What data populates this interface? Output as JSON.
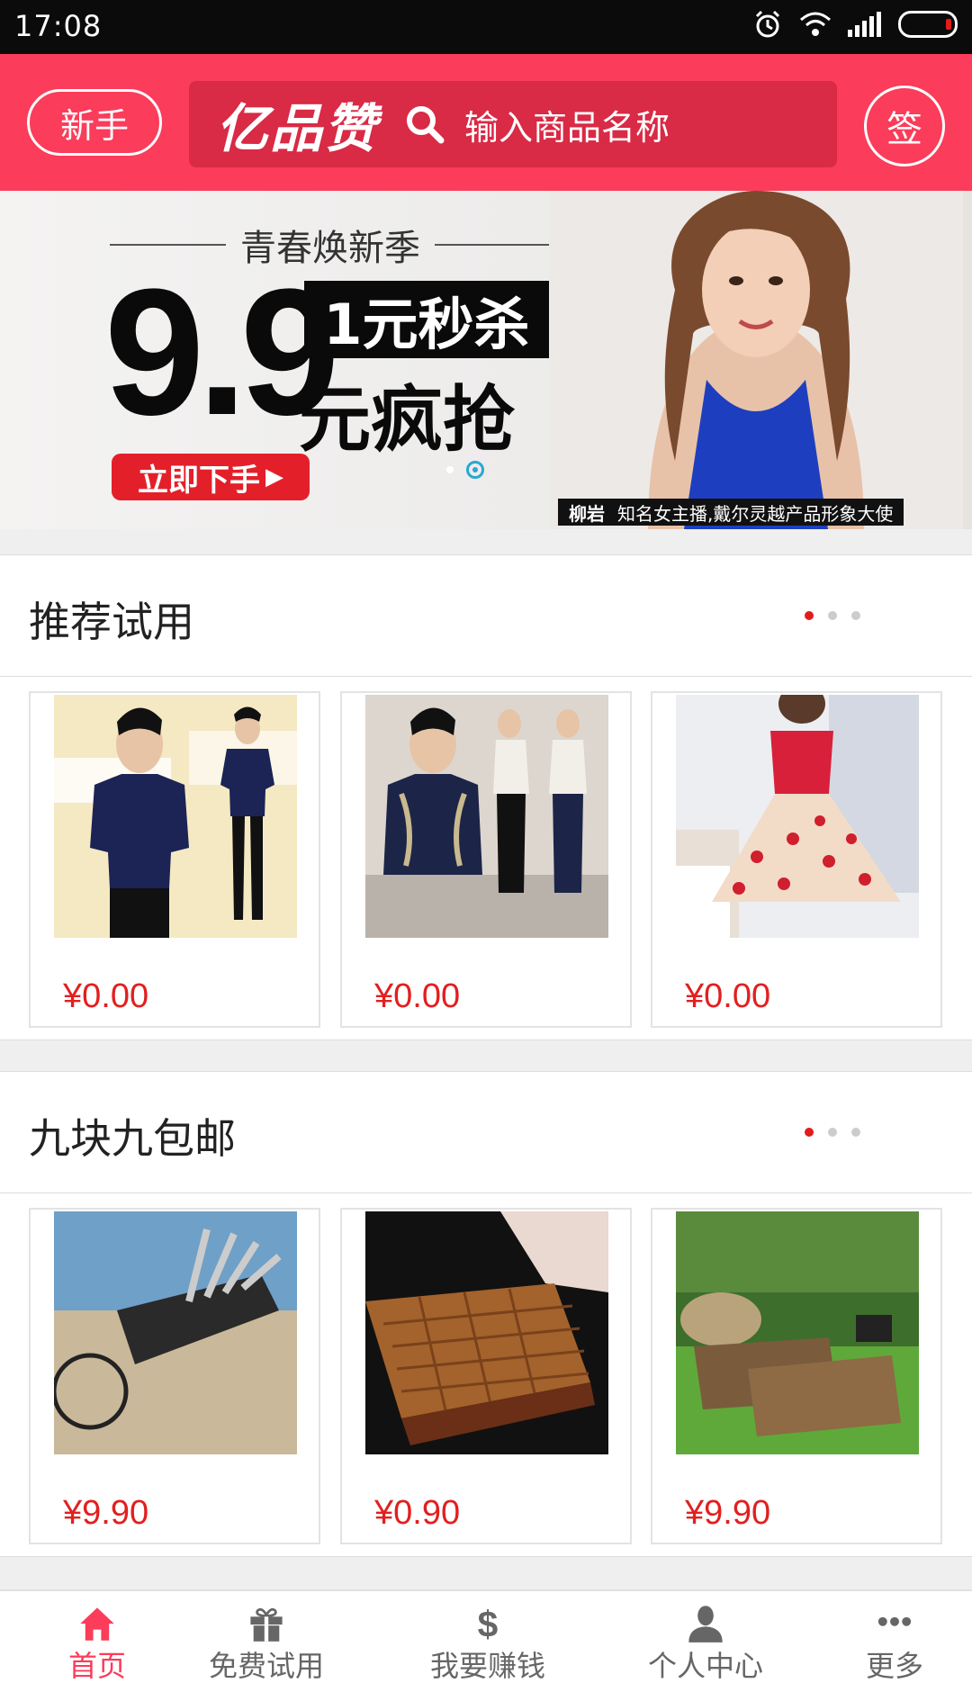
{
  "status_bar": {
    "time": "17:08"
  },
  "header": {
    "newbie_label": "新手",
    "logo_text": "亿品赞",
    "search_placeholder": "输入商品名称",
    "sign_label": "签",
    "accent_color": "#fb3c5a"
  },
  "banner": {
    "tagline": "青春焕新季",
    "big_price": "9.9",
    "seckill_text": "1元秒杀",
    "crazy_text": "元疯抢",
    "cta_label": "立即下手",
    "caption_name": "柳岩",
    "caption_text": "知名女主播,戴尔灵越产品形象大使",
    "pager_count": 2,
    "pager_active": 1
  },
  "sections": [
    {
      "title": "推荐试用",
      "pager_active": 0,
      "items": [
        {
          "price": "¥0.00",
          "image": "mens-navy-shirt"
        },
        {
          "price": "¥0.00",
          "image": "mens-embroidered-shirt"
        },
        {
          "price": "¥0.00",
          "image": "red-cherry-dress"
        }
      ]
    },
    {
      "title": "九块九包邮",
      "pager_active": 0,
      "items": [
        {
          "price": "¥9.90",
          "image": "bicycle-repair-tool"
        },
        {
          "price": "¥0.90",
          "image": "bamboo-seat-cushion"
        },
        {
          "price": "¥9.90",
          "image": "bamboo-pillows"
        }
      ]
    }
  ],
  "tabbar": {
    "items": [
      {
        "label": "首页",
        "icon": "home-icon",
        "active": true
      },
      {
        "label": "免费试用",
        "icon": "gift-icon",
        "active": false
      },
      {
        "label": "我要赚钱",
        "icon": "dollar-icon",
        "active": false
      },
      {
        "label": "个人中心",
        "icon": "user-icon",
        "active": false
      },
      {
        "label": "更多",
        "icon": "more-icon",
        "active": false
      }
    ]
  }
}
